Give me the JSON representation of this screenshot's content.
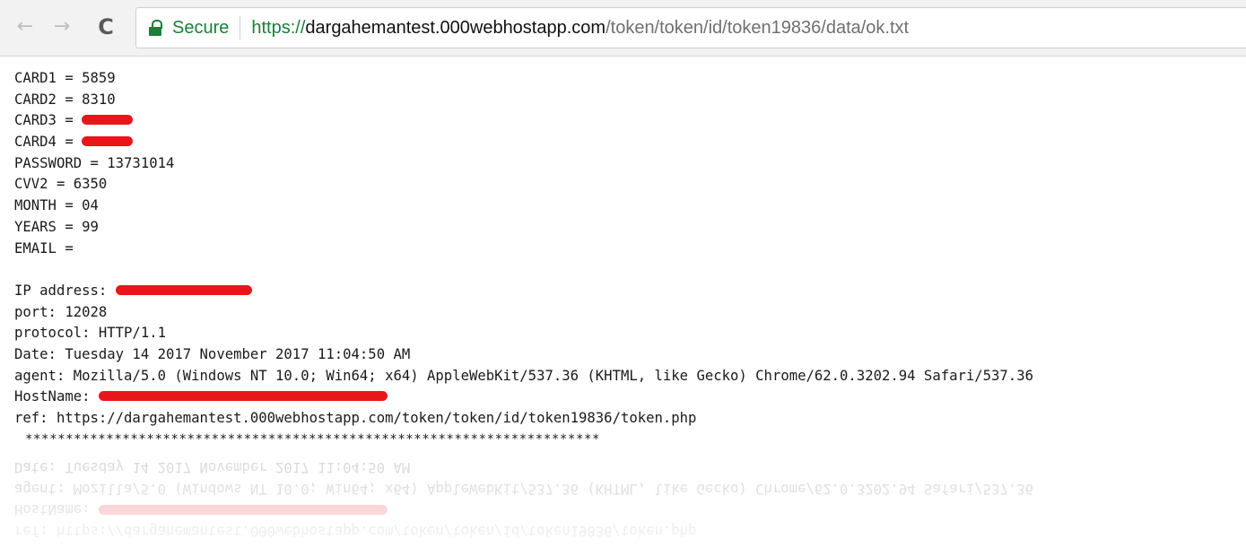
{
  "browser": {
    "back_icon": "←",
    "forward_icon": "→",
    "reload_icon": "C",
    "secure_label": "Secure",
    "url_scheme": "https://",
    "url_host": "dargahemantest.000webhostapp.com",
    "url_path": "/token/token/id/token19836/data/ok.txt"
  },
  "page": {
    "card1": "CARD1 = 5859",
    "card2": "CARD2 = 8310",
    "card3_label": "CARD3 = ",
    "card4_label": "CARD4 = ",
    "password": "PASSWORD = 13731014",
    "cvv2": "CVV2 = 6350",
    "month": "MONTH = 04",
    "years": "YEARS = 99",
    "email": "EMAIL =",
    "ip_label": "IP address: ",
    "port": "port: 12028",
    "protocol": "protocol: HTTP/1.1",
    "date": "Date: Tuesday 14 2017 November 2017 11:04:50 AM",
    "agent": "agent: Mozilla/5.0 (Windows NT 10.0; Win64; x64) AppleWebKit/537.36 (KHTML, like Gecko) Chrome/62.0.3202.94 Safari/537.36",
    "hostname_label": "HostName: ",
    "ref": "ref: https://dargahemantest.000webhostapp.com/token/token/id/token19836/token.php",
    "stars": "***********************************************************************"
  },
  "colors": {
    "redaction": "#e8161b",
    "secure_green": "#188038"
  }
}
